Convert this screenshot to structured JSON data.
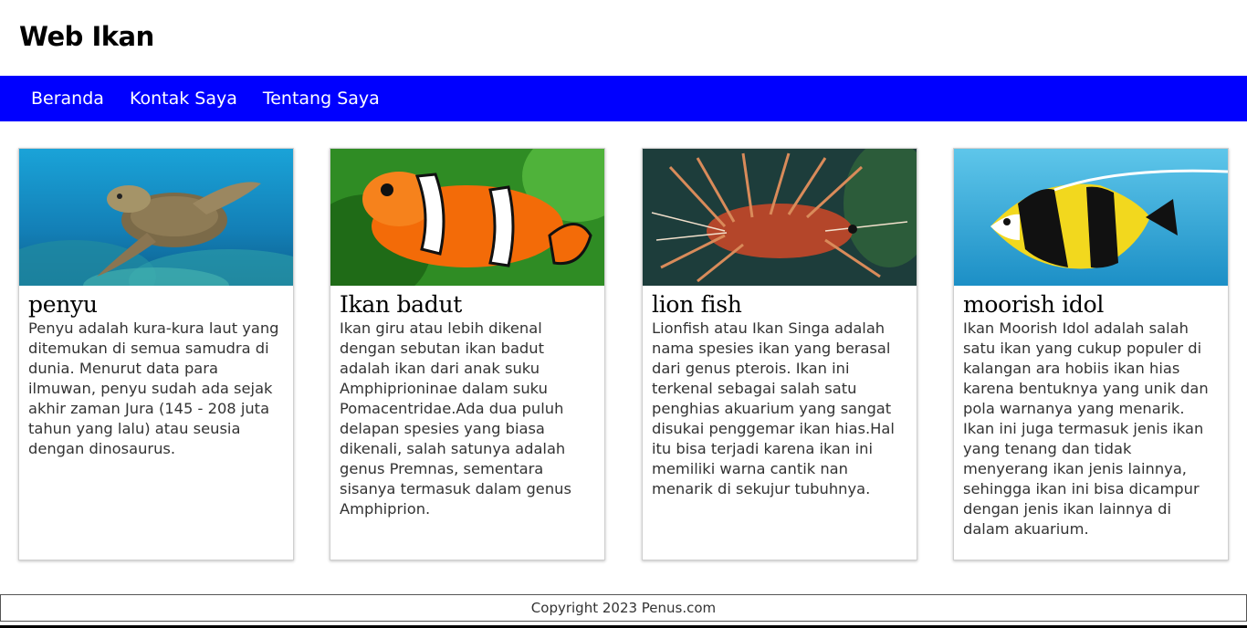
{
  "site": {
    "title": "Web Ikan"
  },
  "nav": {
    "items": [
      {
        "label": "Beranda"
      },
      {
        "label": "Kontak Saya"
      },
      {
        "label": "Tentang Saya"
      }
    ]
  },
  "cards": [
    {
      "title": "penyu",
      "image": "sea-turtle-photo",
      "text": "Penyu adalah kura-kura laut yang ditemukan di semua samudra di dunia. Menurut data para ilmuwan, penyu sudah ada sejak akhir zaman Jura (145 - 208 juta tahun yang lalu) atau seusia dengan dinosaurus."
    },
    {
      "title": "Ikan badut",
      "image": "clownfish-photo",
      "text": "Ikan giru atau lebih dikenal dengan sebutan ikan badut adalah ikan dari anak suku Amphiprioninae dalam suku Pomacentridae.Ada dua puluh delapan spesies yang biasa dikenali, salah satunya adalah genus Premnas, sementara sisanya termasuk dalam genus Amphiprion."
    },
    {
      "title": "lion fish",
      "image": "lionfish-photo",
      "text": "Lionfish atau Ikan Singa adalah nama spesies ikan yang berasal dari genus pterois. Ikan ini terkenal sebagai salah satu penghias akuarium yang sangat disukai penggemar ikan hias.Hal itu bisa terjadi karena ikan ini memiliki warna cantik nan menarik di sekujur tubuhnya."
    },
    {
      "title": "moorish idol",
      "image": "moorish-idol-photo",
      "text": "Ikan Moorish Idol adalah salah satu ikan yang cukup populer di kalangan ara hobiis ikan hias karena bentuknya yang unik dan pola warnanya yang menarik. Ikan ini juga termasuk jenis ikan yang tenang dan tidak menyerang ikan jenis lainnya, sehingga ikan ini bisa dicampur dengan jenis ikan lainnya di dalam akuarium."
    }
  ],
  "footer": {
    "text": "Copyright 2023 Penus.com"
  },
  "colors": {
    "navbar": "#0000ff",
    "nav_text": "#ffffff"
  }
}
